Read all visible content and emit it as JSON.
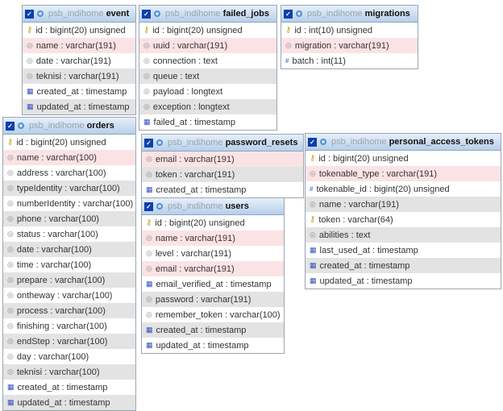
{
  "database": "psb_indihome",
  "tables": [
    {
      "name": "event",
      "columns": [
        {
          "text": "id : bigint(20) unsigned",
          "icon": "key-icon",
          "style": "none"
        },
        {
          "text": "name : varchar(191)",
          "icon": "text-field-icon",
          "style": "pk"
        },
        {
          "text": "date : varchar(191)",
          "icon": "text-field-icon",
          "style": "none"
        },
        {
          "text": "teknisi : varchar(191)",
          "icon": "text-field-icon",
          "style": "alt"
        },
        {
          "text": "created_at : timestamp",
          "icon": "calendar-icon",
          "style": "none"
        },
        {
          "text": "updated_at : timestamp",
          "icon": "calendar-icon",
          "style": "alt"
        }
      ]
    },
    {
      "name": "failed_jobs",
      "columns": [
        {
          "text": "id : bigint(20) unsigned",
          "icon": "key-icon",
          "style": "none"
        },
        {
          "text": "uuid : varchar(191)",
          "icon": "text-field-icon",
          "style": "pk"
        },
        {
          "text": "connection : text",
          "icon": "text-field-icon",
          "style": "none"
        },
        {
          "text": "queue : text",
          "icon": "text-field-icon",
          "style": "alt"
        },
        {
          "text": "payload : longtext",
          "icon": "text-field-icon",
          "style": "none"
        },
        {
          "text": "exception : longtext",
          "icon": "text-field-icon",
          "style": "alt"
        },
        {
          "text": "failed_at : timestamp",
          "icon": "calendar-icon",
          "style": "none"
        }
      ]
    },
    {
      "name": "migrations",
      "columns": [
        {
          "text": "id : int(10) unsigned",
          "icon": "key-icon",
          "style": "none"
        },
        {
          "text": "migration : varchar(191)",
          "icon": "text-field-icon",
          "style": "pk"
        },
        {
          "text": "batch : int(11)",
          "icon": "numeric-icon",
          "style": "none"
        }
      ]
    },
    {
      "name": "orders",
      "columns": [
        {
          "text": "id : bigint(20) unsigned",
          "icon": "key-icon",
          "style": "none"
        },
        {
          "text": "name : varchar(100)",
          "icon": "text-field-icon",
          "style": "pk"
        },
        {
          "text": "address : varchar(100)",
          "icon": "text-field-icon",
          "style": "none"
        },
        {
          "text": "typeIdentity : varchar(100)",
          "icon": "text-field-icon",
          "style": "alt"
        },
        {
          "text": "numberIdentity : varchar(100)",
          "icon": "text-field-icon",
          "style": "none"
        },
        {
          "text": "phone : varchar(100)",
          "icon": "text-field-icon",
          "style": "alt"
        },
        {
          "text": "status : varchar(100)",
          "icon": "text-field-icon",
          "style": "none"
        },
        {
          "text": "date : varchar(100)",
          "icon": "text-field-icon",
          "style": "alt"
        },
        {
          "text": "time : varchar(100)",
          "icon": "text-field-icon",
          "style": "none"
        },
        {
          "text": "prepare : varchar(100)",
          "icon": "text-field-icon",
          "style": "alt"
        },
        {
          "text": "ontheway : varchar(100)",
          "icon": "text-field-icon",
          "style": "none"
        },
        {
          "text": "process : varchar(100)",
          "icon": "text-field-icon",
          "style": "alt"
        },
        {
          "text": "finishing : varchar(100)",
          "icon": "text-field-icon",
          "style": "none"
        },
        {
          "text": "endStep : varchar(100)",
          "icon": "text-field-icon",
          "style": "alt"
        },
        {
          "text": "day : varchar(100)",
          "icon": "text-field-icon",
          "style": "none"
        },
        {
          "text": "teknisi : varchar(100)",
          "icon": "text-field-icon",
          "style": "alt"
        },
        {
          "text": "created_at : timestamp",
          "icon": "calendar-icon",
          "style": "none"
        },
        {
          "text": "updated_at : timestamp",
          "icon": "calendar-icon",
          "style": "alt"
        }
      ]
    },
    {
      "name": "password_resets",
      "columns": [
        {
          "text": "email : varchar(191)",
          "icon": "text-field-icon",
          "style": "pk"
        },
        {
          "text": "token : varchar(191)",
          "icon": "text-field-icon",
          "style": "alt"
        },
        {
          "text": "created_at : timestamp",
          "icon": "calendar-icon",
          "style": "none"
        }
      ]
    },
    {
      "name": "users",
      "columns": [
        {
          "text": "id : bigint(20) unsigned",
          "icon": "key-icon",
          "style": "none"
        },
        {
          "text": "name : varchar(191)",
          "icon": "text-field-icon",
          "style": "pk"
        },
        {
          "text": "level : varchar(191)",
          "icon": "text-field-icon",
          "style": "none"
        },
        {
          "text": "email : varchar(191)",
          "icon": "text-field-icon",
          "style": "pk"
        },
        {
          "text": "email_verified_at : timestamp",
          "icon": "calendar-icon",
          "style": "none"
        },
        {
          "text": "password : varchar(191)",
          "icon": "text-field-icon",
          "style": "alt"
        },
        {
          "text": "remember_token : varchar(100)",
          "icon": "text-field-icon",
          "style": "none"
        },
        {
          "text": "created_at : timestamp",
          "icon": "calendar-icon",
          "style": "alt"
        },
        {
          "text": "updated_at : timestamp",
          "icon": "calendar-icon",
          "style": "none"
        }
      ]
    },
    {
      "name": "personal_access_tokens",
      "columns": [
        {
          "text": "id : bigint(20) unsigned",
          "icon": "key-icon",
          "style": "none"
        },
        {
          "text": "tokenable_type : varchar(191)",
          "icon": "text-field-icon",
          "style": "pk"
        },
        {
          "text": "tokenable_id : bigint(20) unsigned",
          "icon": "numeric-icon",
          "style": "none"
        },
        {
          "text": "name : varchar(191)",
          "icon": "text-field-icon",
          "style": "alt"
        },
        {
          "text": "token : varchar(64)",
          "icon": "key-icon",
          "style": "none"
        },
        {
          "text": "abilities : text",
          "icon": "text-field-icon",
          "style": "alt"
        },
        {
          "text": "last_used_at : timestamp",
          "icon": "calendar-icon",
          "style": "none"
        },
        {
          "text": "created_at : timestamp",
          "icon": "calendar-icon",
          "style": "alt"
        },
        {
          "text": "updated_at : timestamp",
          "icon": "calendar-icon",
          "style": "none"
        }
      ]
    }
  ]
}
